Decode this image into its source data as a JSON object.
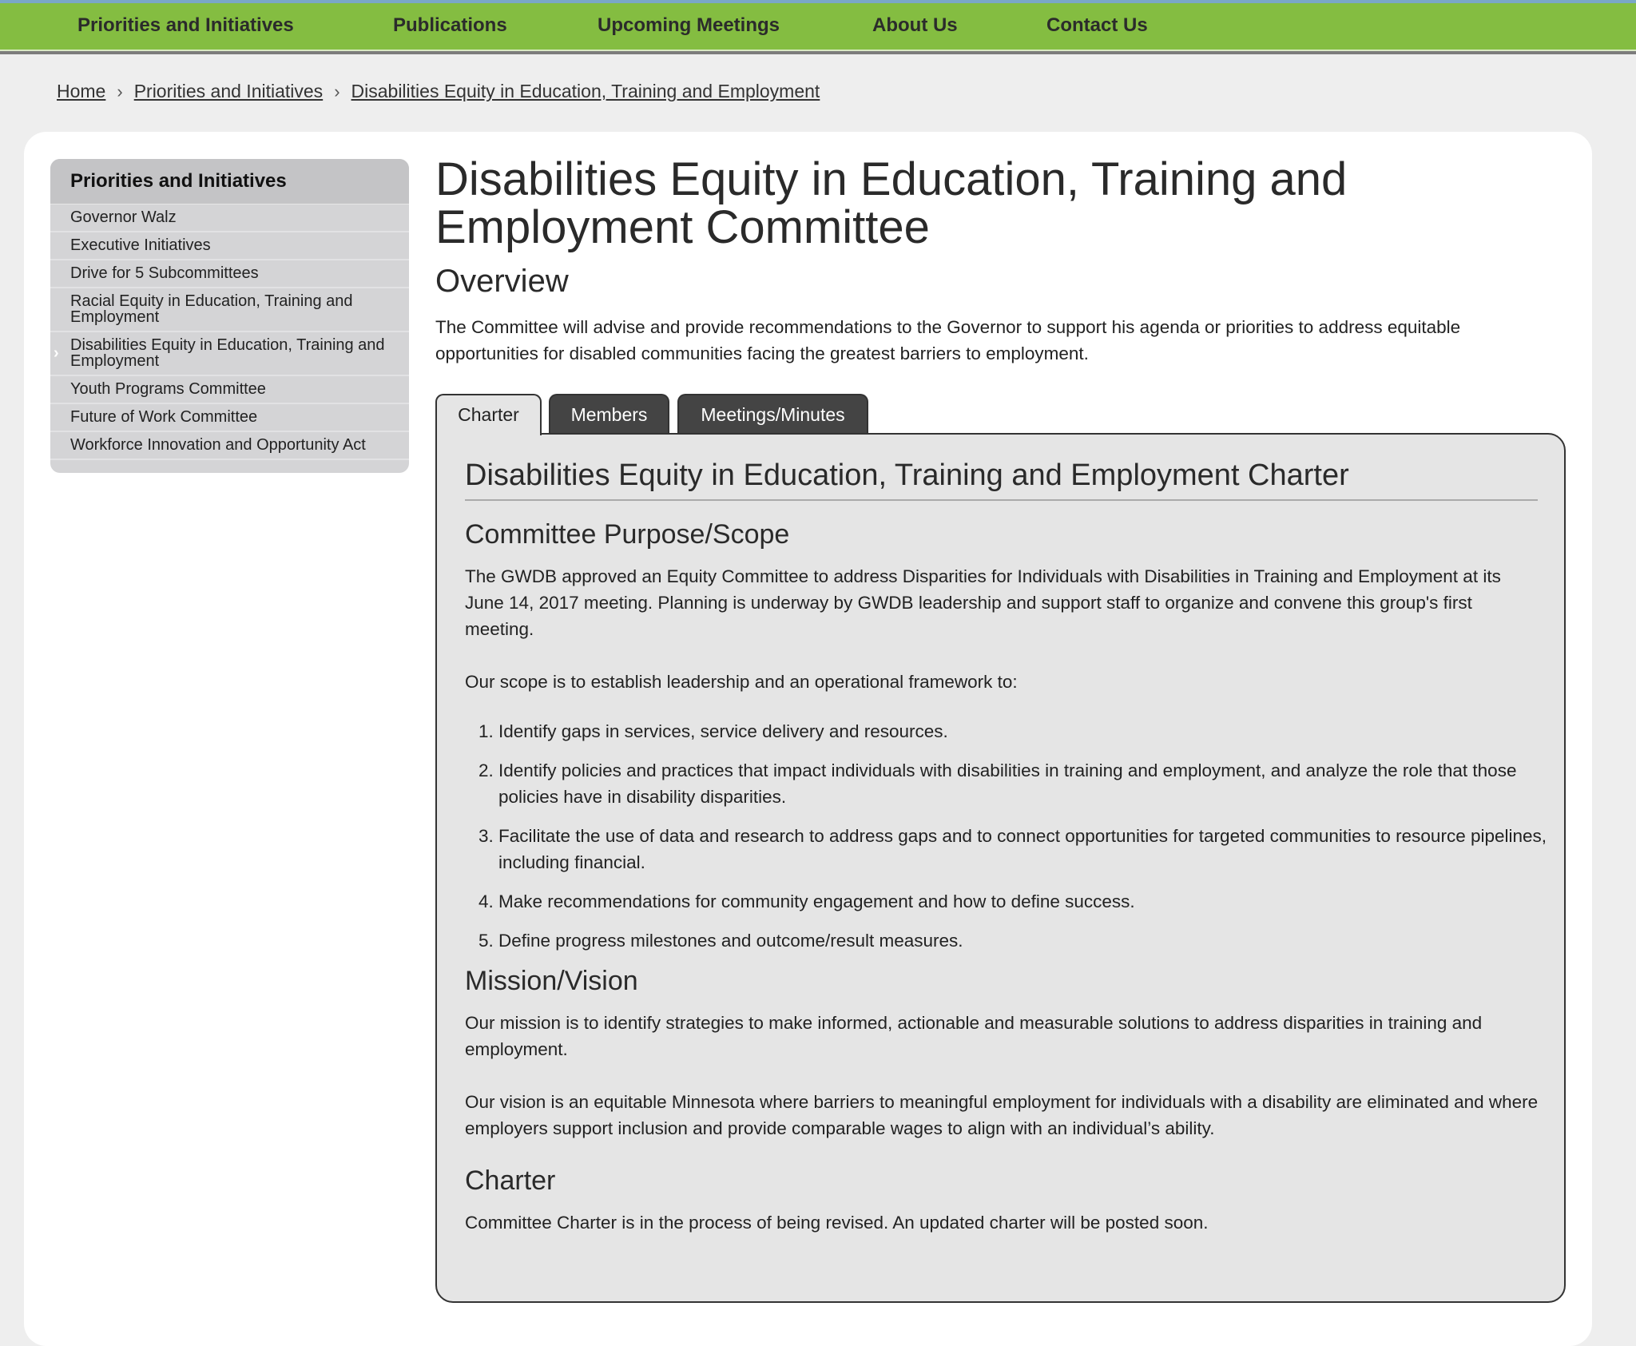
{
  "topnav": {
    "items": [
      {
        "label": "Priorities and Initiatives"
      },
      {
        "label": "Publications"
      },
      {
        "label": "Upcoming Meetings"
      },
      {
        "label": "About Us"
      },
      {
        "label": "Contact Us"
      }
    ]
  },
  "breadcrumb": {
    "items": [
      {
        "label": "Home"
      },
      {
        "label": "Priorities and Initiatives"
      },
      {
        "label": "Disabilities Equity in Education, Training and Employment"
      }
    ],
    "separator": "›"
  },
  "sidebar": {
    "heading": "Priorities and Initiatives",
    "items": [
      {
        "label": "Governor Walz"
      },
      {
        "label": "Executive Initiatives"
      },
      {
        "label": "Drive for 5 Subcommittees"
      },
      {
        "label": "Racial Equity in Education, Training and Employment"
      },
      {
        "label": "Disabilities Equity in Education, Training and Employment"
      },
      {
        "label": "Youth Programs Committee"
      },
      {
        "label": "Future of Work Committee"
      },
      {
        "label": "Workforce Innovation and Opportunity Act"
      }
    ],
    "active_marker": "›"
  },
  "page": {
    "title": "Disabilities Equity in Education, Training and Employment Committee",
    "overview_heading": "Overview",
    "overview_text": "The Committee will advise and provide recommendations to the Governor to support his agenda or priorities to address equitable opportunities for disabled communities facing the greatest barriers to employment."
  },
  "tabs": [
    {
      "label": "Charter",
      "active": true
    },
    {
      "label": "Members",
      "active": false
    },
    {
      "label": "Meetings/Minutes",
      "active": false
    }
  ],
  "charter": {
    "title": "Disabilities Equity in Education, Training and Employment Charter",
    "purpose_heading": "Committee Purpose/Scope",
    "purpose_text": "The GWDB approved an Equity Committee to address Disparities for Individuals with Disabilities in Training and Employment at its June 14, 2017 meeting. Planning is underway by GWDB leadership and support staff to organize and convene this group's first meeting.",
    "scope_intro": "Our scope is to establish leadership and an operational framework to:",
    "scope_items": [
      "Identify gaps in services, service delivery and resources.",
      "Identify policies and practices that impact individuals with disabilities in training and employment, and analyze the role that those policies have in disability disparities.",
      "Facilitate the use of data and research to address gaps and to connect opportunities for targeted communities to resource pipelines, including financial.",
      "Make recommendations for community engagement and how to define success.",
      "Define progress milestones and outcome/result measures."
    ],
    "mission_heading": "Mission/Vision",
    "mission_text": "Our mission is to identify strategies to make informed, actionable and measurable solutions to address disparities in training and employment.",
    "vision_text": "Our vision is an equitable Minnesota where barriers to meaningful employment for individuals with a disability are eliminated and where employers support inclusion and provide comparable wages to align with an individual’s ability.",
    "charter_heading": "Charter",
    "charter_text": "Committee Charter is in the process of being revised. An updated charter will be posted soon."
  },
  "colors": {
    "nav_green": "#84bd41",
    "tab_dark": "#444444",
    "panel_bg": "#e5e5e5",
    "sidebar_bg": "#d4d4d6",
    "page_bg": "#eeeeee"
  }
}
